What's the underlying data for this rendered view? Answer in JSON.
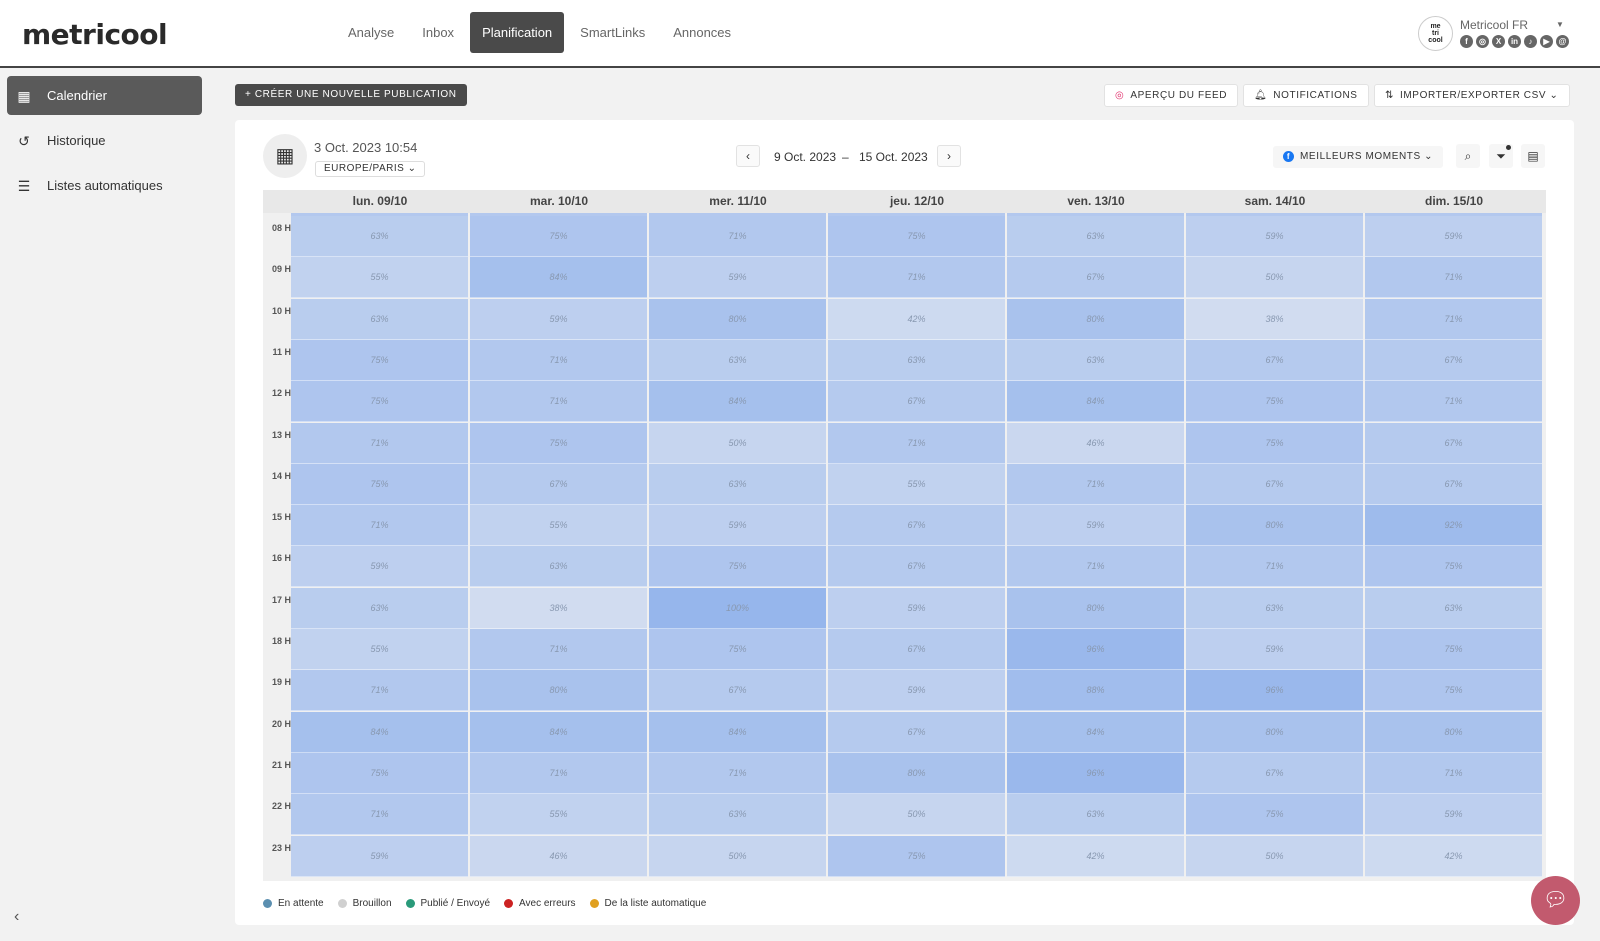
{
  "logo": "metricool",
  "nav": [
    "Analyse",
    "Inbox",
    "Planification",
    "SmartLinks",
    "Annonces"
  ],
  "nav_active": 2,
  "account": {
    "avatar_text": "me tri cool",
    "name": "Metricool FR"
  },
  "social_icons": [
    "facebook-icon",
    "instagram-icon",
    "x-icon",
    "linkedin-icon",
    "tiktok-icon",
    "youtube-icon",
    "threads-icon"
  ],
  "sidebar": [
    {
      "label": "Calendrier",
      "icon": "calendar-icon",
      "glyph": "▦",
      "active": true
    },
    {
      "label": "Historique",
      "icon": "history-icon",
      "glyph": "↺",
      "active": false
    },
    {
      "label": "Listes automatiques",
      "icon": "list-icon",
      "glyph": "☰",
      "active": false
    }
  ],
  "toolbar": {
    "create": "+  CRÉER UNE NOUVELLE PUBLICATION",
    "feed": "APERÇU DU FEED",
    "notifications": "NOTIFICATIONS",
    "import_export": "IMPORTER/EXPORTER CSV"
  },
  "calendar": {
    "current_datetime": "3 Oct. 2023 10:54",
    "timezone": "EUROPE/PARIS",
    "range_start": "9 Oct. 2023",
    "range_sep": "–",
    "range_end": "15 Oct. 2023",
    "best_moments": "MEILLEURS MOMENTS"
  },
  "days": [
    "lun. 09/10",
    "mar. 10/10",
    "mer. 11/10",
    "jeu. 12/10",
    "ven. 13/10",
    "sam. 14/10",
    "dim. 15/10"
  ],
  "hours": [
    "08 H",
    "09 H",
    "10 H",
    "11 H",
    "12 H",
    "13 H",
    "14 H",
    "15 H",
    "16 H",
    "17 H",
    "18 H",
    "19 H",
    "20 H",
    "21 H",
    "22 H",
    "23 H"
  ],
  "heatmap": [
    [
      63,
      75,
      71,
      75,
      63,
      59,
      59
    ],
    [
      55,
      84,
      59,
      71,
      67,
      50,
      71
    ],
    [
      63,
      59,
      80,
      42,
      80,
      38,
      71
    ],
    [
      75,
      71,
      63,
      63,
      63,
      67,
      67
    ],
    [
      75,
      71,
      84,
      67,
      84,
      75,
      71
    ],
    [
      71,
      75,
      50,
      71,
      46,
      75,
      67
    ],
    [
      75,
      67,
      63,
      55,
      71,
      67,
      67
    ],
    [
      71,
      55,
      59,
      67,
      59,
      80,
      92
    ],
    [
      59,
      63,
      75,
      67,
      71,
      71,
      75
    ],
    [
      63,
      38,
      100,
      59,
      80,
      63,
      63
    ],
    [
      55,
      71,
      75,
      67,
      96,
      59,
      75
    ],
    [
      71,
      80,
      67,
      59,
      88,
      96,
      75
    ],
    [
      84,
      84,
      84,
      67,
      84,
      80,
      80
    ],
    [
      75,
      71,
      71,
      80,
      96,
      67,
      71
    ],
    [
      71,
      55,
      63,
      50,
      63,
      75,
      59
    ],
    [
      59,
      46,
      50,
      75,
      42,
      50,
      42
    ]
  ],
  "legend": [
    {
      "label": "En attente",
      "color": "#5b8fb0"
    },
    {
      "label": "Brouillon",
      "color": "#d0d0d0"
    },
    {
      "label": "Publié / Envoyé",
      "color": "#2a9a7a"
    },
    {
      "label": "Avec erreurs",
      "color": "#cc2222"
    },
    {
      "label": "De la liste automatique",
      "color": "#e0a020"
    }
  ]
}
